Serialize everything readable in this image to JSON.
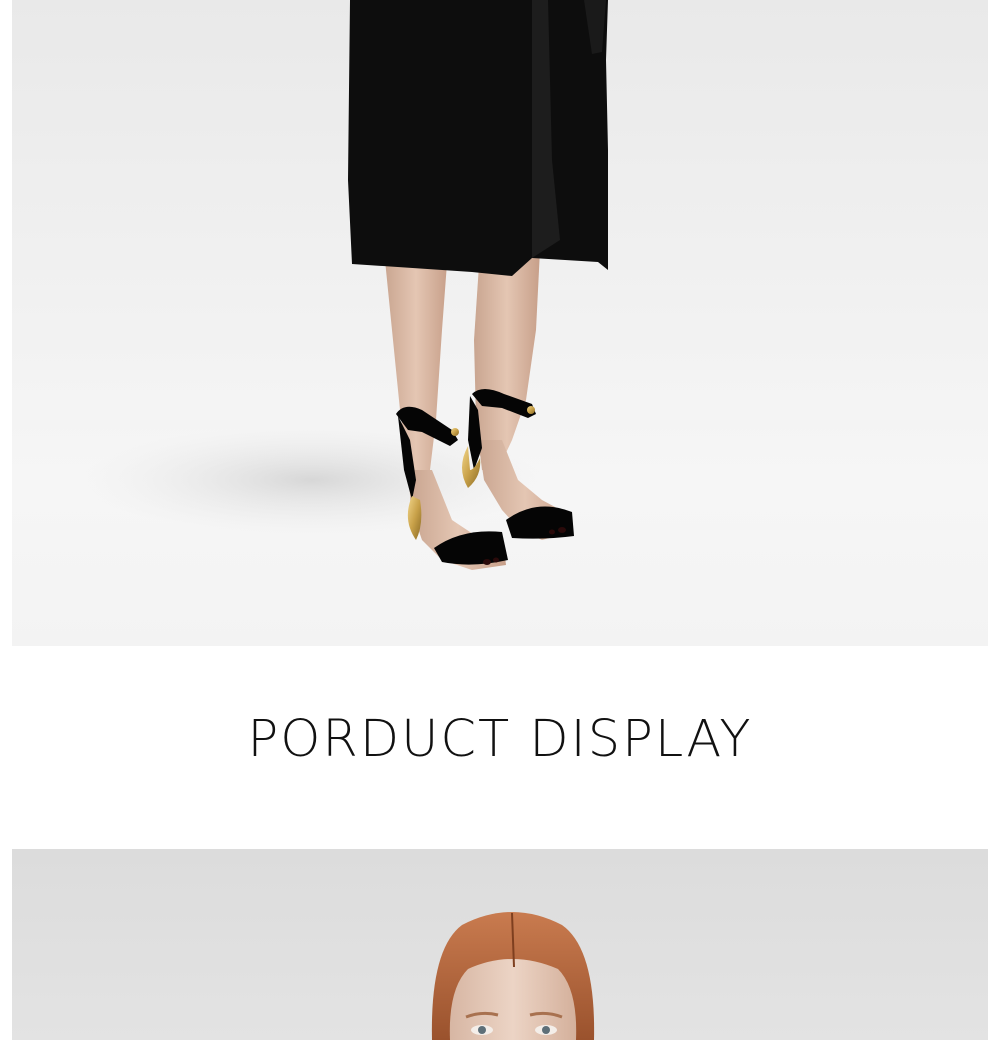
{
  "heading": {
    "title": "PORDUCT DISPLAY"
  },
  "photos": [
    {
      "icon": "model-legs-sandals-photo"
    },
    {
      "icon": "model-portrait-photo"
    }
  ],
  "colors": {
    "page_background": "#ffffff",
    "coat": "#0d0d0d",
    "skin": "#d9b9a4",
    "sandal_strap": "#050505",
    "heel_gold": "#c9a24a",
    "hair": "#b4653c",
    "heading_text": "#111111"
  }
}
